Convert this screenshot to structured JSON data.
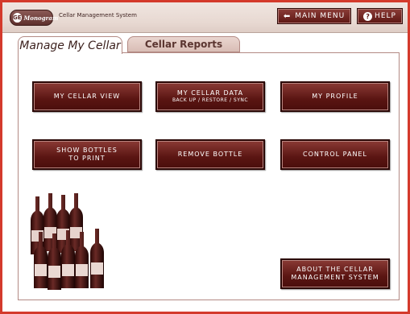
{
  "header": {
    "logo_text": "Monogram",
    "app_title": "Cellar Management System",
    "main_menu_label": "MAIN MENU",
    "help_label": "HELP"
  },
  "tabs": [
    {
      "label": "Manage My Cellar",
      "active": true
    },
    {
      "label": "Cellar Reports",
      "active": false
    }
  ],
  "buttons": {
    "my_cellar_view": {
      "line1": "MY CELLAR VIEW"
    },
    "my_cellar_data": {
      "line1": "MY CELLAR DATA",
      "line2": "BACK UP / RESTORE / SYNC"
    },
    "my_profile": {
      "line1": "MY PROFILE"
    },
    "show_bottles": {
      "line1": "SHOW BOTTLES",
      "line2": "TO PRINT"
    },
    "remove_bottle": {
      "line1": "REMOVE BOTTLE"
    },
    "control_panel": {
      "line1": "CONTROL PANEL"
    },
    "about": {
      "line1": "ABOUT THE CELLAR",
      "line2": "MANAGEMENT SYSTEM"
    }
  },
  "colors": {
    "frame_border": "#d43a2c",
    "button_fill": "#5a1512",
    "button_text": "#ffffff"
  },
  "icons": {
    "main_menu": "arrow-left-icon",
    "help": "question-circle-icon",
    "logo": "ge-logo-icon"
  }
}
